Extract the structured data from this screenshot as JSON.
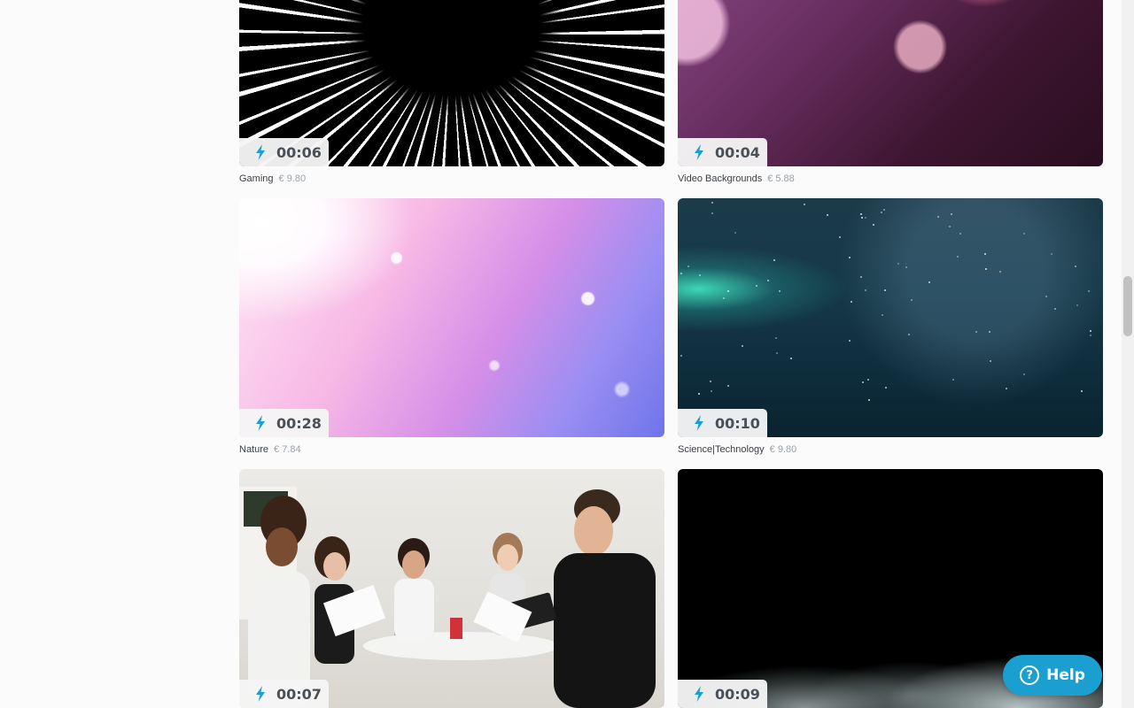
{
  "colors": {
    "accent": "#1a9fd0",
    "badge_text": "#4a5058",
    "price": "#9aa0a6"
  },
  "videos": [
    {
      "duration": "00:06",
      "category": "Gaming",
      "price": "€ 9.80",
      "icon": "lightning-bolt-icon"
    },
    {
      "duration": "00:04",
      "category": "Video Backgrounds",
      "price": "€ 5.88",
      "icon": "lightning-bolt-icon"
    },
    {
      "duration": "00:28",
      "category": "Nature",
      "price": "€ 7.84",
      "icon": "lightning-bolt-icon"
    },
    {
      "duration": "00:10",
      "category": "Science|Technology",
      "price": "€ 9.80",
      "icon": "lightning-bolt-icon"
    },
    {
      "duration": "00:07",
      "category": "",
      "price": "",
      "icon": "lightning-bolt-icon"
    },
    {
      "duration": "00:09",
      "category": "",
      "price": "",
      "icon": "lightning-bolt-icon"
    }
  ],
  "help": {
    "label": "Help",
    "icon": "question-circle-icon"
  }
}
